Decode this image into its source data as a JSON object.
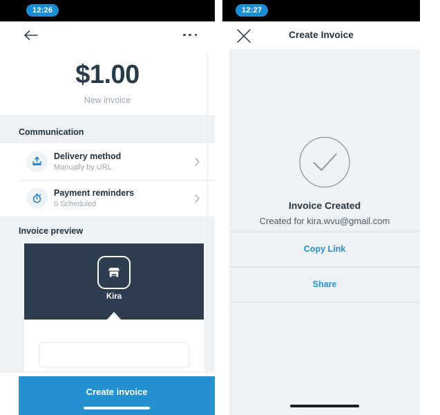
{
  "left_screen": {
    "status_bar": {
      "time": "12:26"
    },
    "nav": {
      "back_icon": "arrow-left-icon",
      "overflow_icon": "more-horizontal-icon"
    },
    "header": {
      "amount": "$1.00",
      "subtitle": "New invoice"
    },
    "communication": {
      "section_label": "Communication",
      "rows": [
        {
          "icon": "upload-share-icon",
          "title": "Delivery method",
          "subtitle": "Manually by URL",
          "chevron": "chevron-right-icon"
        },
        {
          "icon": "stopwatch-icon",
          "title": "Payment reminders",
          "subtitle": "0 Scheduled",
          "chevron": "chevron-right-icon"
        }
      ]
    },
    "preview": {
      "section_label": "Invoice preview",
      "merchant_icon": "storefront-icon",
      "merchant_name": "Kira"
    },
    "cta": {
      "label": "Create invoice"
    },
    "colors": {
      "accent_blue": "#2391cf",
      "time_pill_blue": "#1b8ed6",
      "preview_dark": "#2e3e4e",
      "band_gray": "#eef2f5",
      "title_navy": "#21313e",
      "muted_gray": "#9aa7b2"
    }
  },
  "right_screen": {
    "status_bar": {
      "time": "12:27"
    },
    "nav": {
      "close_icon": "close-x-icon",
      "title": "Create Invoice"
    },
    "success": {
      "icon": "check-circle-icon",
      "title": "Invoice Created",
      "subtitle": "Created for kira.wvu@gmail.com"
    },
    "actions": [
      {
        "label": "Copy Link"
      },
      {
        "label": "Share"
      }
    ]
  }
}
